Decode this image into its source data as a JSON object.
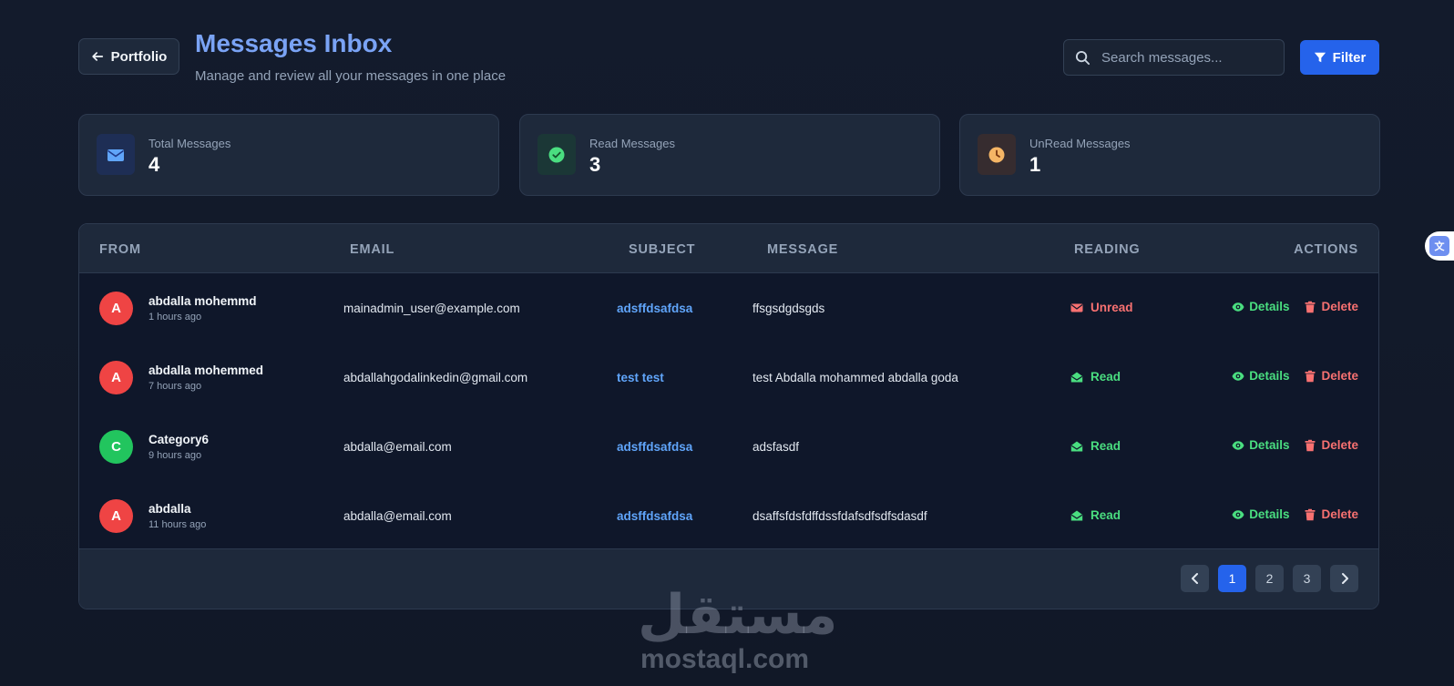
{
  "header": {
    "back_label": "Portfolio",
    "title": "Messages Inbox",
    "subtitle": "Manage and review all your messages in one place",
    "search_placeholder": "Search messages...",
    "filter_label": "Filter"
  },
  "stats": [
    {
      "label": "Total Messages",
      "value": "4",
      "icon": "envelope-icon",
      "color": "#60a5fa",
      "bg": "#1e3a8a55"
    },
    {
      "label": "Read Messages",
      "value": "3",
      "icon": "check-circle-icon",
      "color": "#4ade80",
      "bg": "#14532d55"
    },
    {
      "label": "UnRead Messages",
      "value": "1",
      "icon": "clock-icon",
      "color": "#f5b565",
      "bg": "#78350f44"
    }
  ],
  "table": {
    "columns": {
      "from": "FROM",
      "email": "EMAIL",
      "subject": "SUBJECT",
      "message": "MESSAGE",
      "reading": "READING",
      "actions": "ACTIONS"
    },
    "rows": [
      {
        "initial": "A",
        "avatar_color": "#ef4444",
        "name": "abdalla mohemmd",
        "time": "1 hours ago",
        "email": "mainadmin_user@example.com",
        "subject": "adsffdsafdsa",
        "message": "ffsgsdgdsgds",
        "status": "Unread",
        "status_color": "#f87171",
        "status_icon": "envelope-icon"
      },
      {
        "initial": "A",
        "avatar_color": "#ef4444",
        "name": "abdalla mohemmed",
        "time": "7 hours ago",
        "email": "abdallahgodalinkedin@gmail.com",
        "subject": "test test",
        "message": "test Abdalla mohammed abdalla goda",
        "status": "Read",
        "status_color": "#4ade80",
        "status_icon": "envelope-open-icon"
      },
      {
        "initial": "C",
        "avatar_color": "#22c55e",
        "name": "Category6",
        "time": "9 hours ago",
        "email": "abdalla@email.com",
        "subject": "adsffdsafdsa",
        "message": "adsfasdf",
        "status": "Read",
        "status_color": "#4ade80",
        "status_icon": "envelope-open-icon"
      },
      {
        "initial": "A",
        "avatar_color": "#ef4444",
        "name": "abdalla",
        "time": "11 hours ago",
        "email": "abdalla@email.com",
        "subject": "adsffdsafdsa",
        "message": "dsaffsfdsfdffdssfdafsdfsdfsdasdf",
        "status": "Read",
        "status_color": "#4ade80",
        "status_icon": "envelope-open-icon"
      }
    ],
    "actions": {
      "details": "Details",
      "delete": "Delete"
    }
  },
  "pagination": {
    "pages": [
      "1",
      "2",
      "3"
    ],
    "current": "1"
  },
  "watermark": {
    "arabic": "مستقل",
    "latin": "mostaql.com"
  }
}
